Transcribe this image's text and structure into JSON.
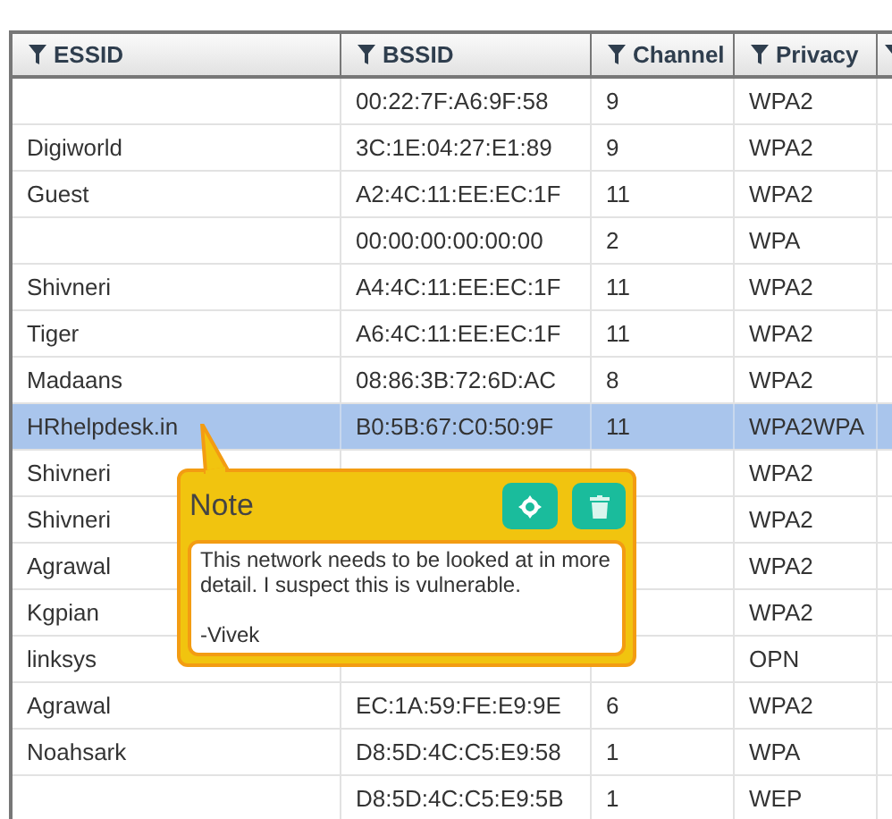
{
  "table": {
    "columns": [
      {
        "label": "ESSID"
      },
      {
        "label": "BSSID"
      },
      {
        "label": "Channel"
      },
      {
        "label": "Privacy"
      }
    ],
    "rows": [
      {
        "essid": "",
        "bssid": "00:22:7F:A6:9F:58",
        "channel": "9",
        "privacy": "WPA2",
        "selected": false
      },
      {
        "essid": "Digiworld",
        "bssid": "3C:1E:04:27:E1:89",
        "channel": "9",
        "privacy": "WPA2",
        "selected": false
      },
      {
        "essid": "Guest",
        "bssid": "A2:4C:11:EE:EC:1F",
        "channel": "11",
        "privacy": "WPA2",
        "selected": false
      },
      {
        "bssid": "00:00:00:00:00:00",
        "channel": "2",
        "privacy": "WPA",
        "selected": false
      },
      {
        "essid": "Shivneri",
        "bssid": "A4:4C:11:EE:EC:1F",
        "channel": "11",
        "privacy": "WPA2",
        "selected": false
      },
      {
        "essid": "Tiger",
        "bssid": "A6:4C:11:EE:EC:1F",
        "channel": "11",
        "privacy": "WPA2",
        "selected": false
      },
      {
        "essid": "Madaans",
        "bssid": "08:86:3B:72:6D:AC",
        "channel": "8",
        "privacy": "WPA2",
        "selected": false
      },
      {
        "essid": "HRhelpdesk.in",
        "bssid": "B0:5B:67:C0:50:9F",
        "channel": "11",
        "privacy": "WPA2WPA",
        "selected": true
      },
      {
        "essid": "Shivneri",
        "privacy": "WPA2",
        "selected": false
      },
      {
        "essid": "Shivneri",
        "privacy": "WPA2",
        "selected": false
      },
      {
        "essid": "Agrawal",
        "privacy": "WPA2",
        "selected": false
      },
      {
        "essid": "Kgpian",
        "privacy": "WPA2",
        "selected": false
      },
      {
        "essid": "linksys",
        "privacy": "OPN",
        "selected": false
      },
      {
        "essid": "Agrawal",
        "bssid": "EC:1A:59:FE:E9:9E",
        "channel": "6",
        "privacy": "WPA2",
        "selected": false
      },
      {
        "essid": "Noahsark",
        "bssid": "D8:5D:4C:C5:E9:58",
        "channel": "1",
        "privacy": "WPA",
        "selected": false
      },
      {
        "bssid": "D8:5D:4C:C5:E9:5B",
        "channel": "1",
        "privacy": "WEP",
        "selected": false
      }
    ]
  },
  "note": {
    "title": "Note",
    "text": "This network needs to be looked at in more detail. I suspect this is vulnerable.\n\n-Vivek"
  }
}
